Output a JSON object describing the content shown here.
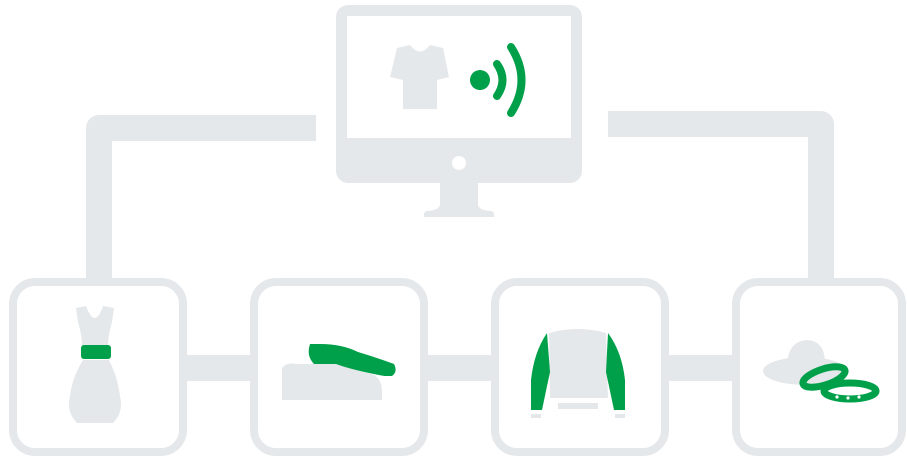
{
  "diagram": {
    "colors": {
      "gray": "#E5E8EB",
      "green": "#00A04A",
      "white": "#FFFFFF"
    },
    "hub": {
      "device": "desktop-monitor",
      "icons": [
        "tshirt-icon",
        "wireless-signal-icon"
      ]
    },
    "items": [
      {
        "name": "dress",
        "icon": "dress-icon"
      },
      {
        "name": "shoe",
        "icon": "shoe-icon"
      },
      {
        "name": "sweater",
        "icon": "sweater-icon"
      },
      {
        "name": "hat-and-bracelets",
        "icon": "hat-bracelets-icon"
      }
    ]
  }
}
